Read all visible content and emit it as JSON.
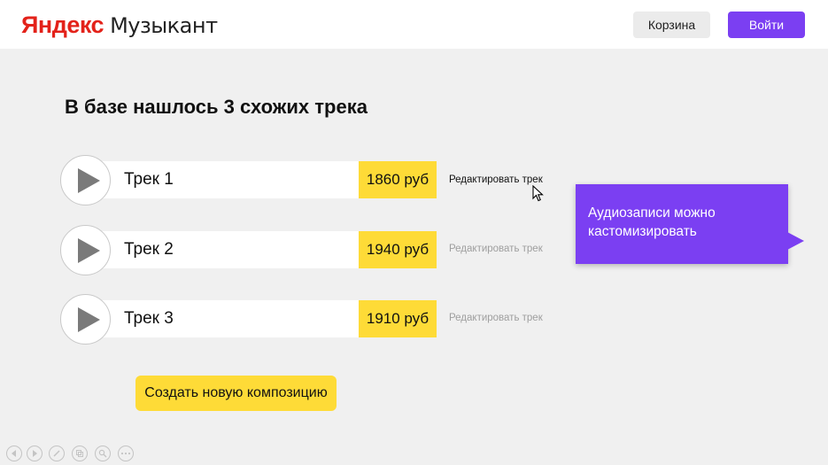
{
  "header": {
    "logo_brand": "Яндекс",
    "logo_product": "Музыкант",
    "cart_label": "Корзина",
    "login_label": "Войти"
  },
  "main": {
    "title": "В базе нашлось 3 схожих трека",
    "tracks": [
      {
        "name": "Трек 1",
        "price": "1860 руб",
        "edit_label": "Редактировать трек"
      },
      {
        "name": "Трек 2",
        "price": "1940 руб",
        "edit_label": "Редактировать трек"
      },
      {
        "name": "Трек 3",
        "price": "1910 руб",
        "edit_label": "Редактировать трек"
      }
    ],
    "create_button": "Создать новую композицию"
  },
  "callout": {
    "text": "Аудиозаписи можно кастомизировать"
  },
  "icons": [
    "play-icon",
    "cursor-icon",
    "prev-icon",
    "next-icon",
    "pen-icon",
    "copy-icon",
    "zoom-icon",
    "more-icon"
  ],
  "colors": {
    "accent": "#7b3ff2",
    "highlight": "#fedb37",
    "brand": "#e3221a",
    "background": "#f0f0f0"
  }
}
